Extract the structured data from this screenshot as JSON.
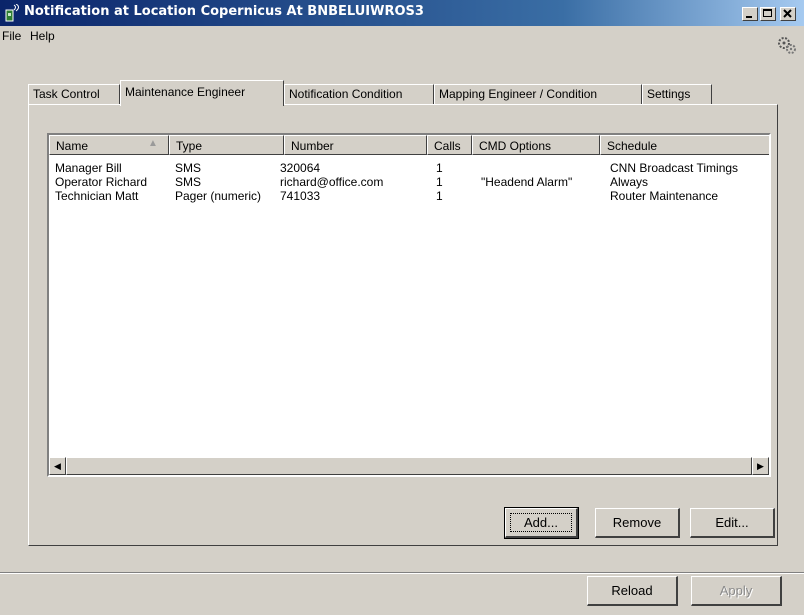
{
  "window": {
    "title": "Notification at Location Copernicus At BNBELUIWROS3"
  },
  "menu": {
    "file": "File",
    "help": "Help"
  },
  "tabs": [
    {
      "label": "Task Control"
    },
    {
      "label": "Maintenance Engineer"
    },
    {
      "label": "Notification Condition"
    },
    {
      "label": "Mapping Engineer / Condition"
    },
    {
      "label": "Settings"
    }
  ],
  "list": {
    "columns": [
      "Name",
      "Type",
      "Number",
      "Calls",
      "CMD Options",
      "Schedule"
    ],
    "rows": [
      {
        "name": "Manager Bill",
        "type": "SMS",
        "number": "320064",
        "calls": "1",
        "cmd": "",
        "schedule": "CNN Broadcast Timings"
      },
      {
        "name": "Operator Richard",
        "type": "SMS",
        "number": "richard@office.com",
        "calls": "1",
        "cmd": "\"Headend Alarm\"",
        "schedule": "Always"
      },
      {
        "name": "Technician Matt",
        "type": "Pager (numeric)",
        "number": "741033",
        "calls": "1",
        "cmd": "",
        "schedule": "Router Maintenance"
      }
    ]
  },
  "buttons": {
    "add": "Add...",
    "remove": "Remove",
    "edit": "Edit...",
    "reload": "Reload",
    "apply": "Apply"
  }
}
